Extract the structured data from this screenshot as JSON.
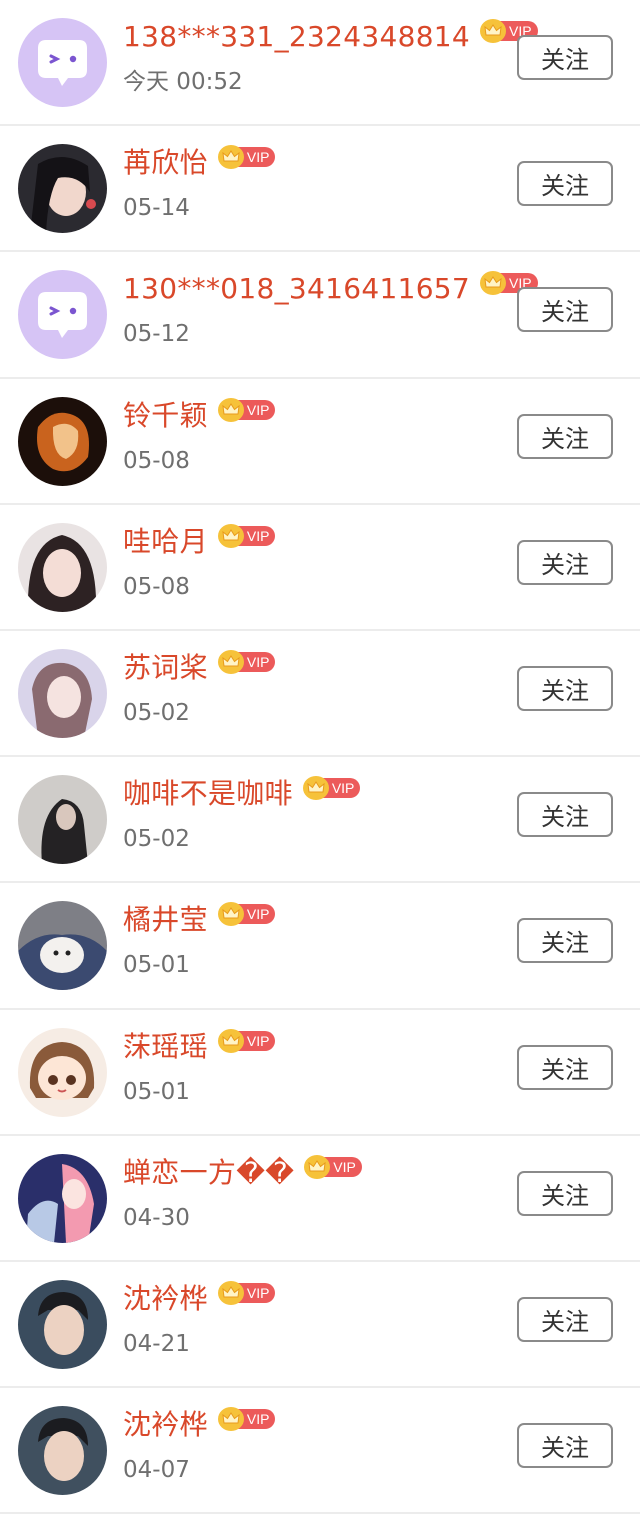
{
  "follow_label": "关注",
  "vip_label": "VIP",
  "users": [
    {
      "name": "138***331_2324348814",
      "date": "今天 00:52",
      "avatar": "default-chat-avatar"
    },
    {
      "name": "苒欣怡",
      "date": "05-14",
      "avatar": "photo-avatar"
    },
    {
      "name": "130***018_3416411657",
      "date": "05-12",
      "avatar": "default-chat-avatar"
    },
    {
      "name": "铃千颖",
      "date": "05-08",
      "avatar": "photo-avatar"
    },
    {
      "name": "哇哈月",
      "date": "05-08",
      "avatar": "photo-avatar"
    },
    {
      "name": "苏词桨",
      "date": "05-02",
      "avatar": "photo-avatar"
    },
    {
      "name": "咖啡不是咖啡",
      "date": "05-02",
      "avatar": "photo-avatar"
    },
    {
      "name": "橘井莹",
      "date": "05-01",
      "avatar": "photo-avatar"
    },
    {
      "name": "莯瑶瑶",
      "date": "05-01",
      "avatar": "cartoon-avatar"
    },
    {
      "name": "蝉恋一方��",
      "date": "04-30",
      "avatar": "photo-avatar"
    },
    {
      "name": "沈衿桦",
      "date": "04-21",
      "avatar": "photo-avatar"
    },
    {
      "name": "沈衿桦",
      "date": "04-07",
      "avatar": "photo-avatar"
    }
  ],
  "colors": {
    "name": "#d9482a",
    "date": "#6f6f6f",
    "vip_tag": "#ec5a5a",
    "crown": "#f6c23a",
    "default_avatar_bg": "#d6c4f5"
  }
}
